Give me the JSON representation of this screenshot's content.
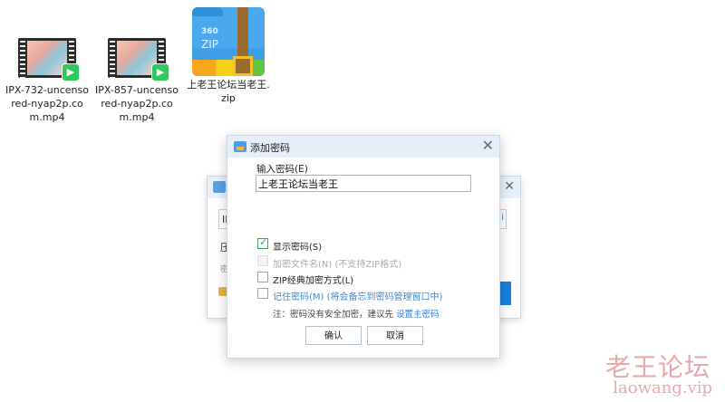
{
  "desktop": {
    "files": [
      {
        "name": "IPX-732-uncensored-nyap2p.com.mp4"
      },
      {
        "name": "IPX-857-uncensored-nyap2p.com.mp4"
      }
    ],
    "zip": {
      "name": "上老王论坛当老王.zip",
      "brand": "360",
      "label": "ZIP"
    }
  },
  "back_dialog": {
    "field_prefix": "IP",
    "label_1": "压",
    "label_2": "密"
  },
  "dialog": {
    "title": "添加密码",
    "password_label": "输入密码(E)",
    "password_value": "上老王论坛当老王",
    "options": [
      {
        "label": "显示密码(S)",
        "checked": true,
        "disabled": false
      },
      {
        "label": "加密文件名(N) (不支持ZIP格式)",
        "checked": false,
        "disabled": true
      },
      {
        "label": "ZIP经典加密方式(L)",
        "checked": false,
        "disabled": false
      },
      {
        "label": "记住密码(M) (将会备忘到密码管理窗口中)",
        "checked": false,
        "disabled": false
      }
    ],
    "note_text": "注：密码没有安全加密，建议先",
    "note_link": "设置主密码",
    "ok_label": "确认",
    "cancel_label": "取消"
  },
  "watermark": {
    "line1": "老王论坛",
    "line2": "laowang.vip"
  },
  "colors": {
    "accent": "#2a7fd4",
    "check": "#3aa455",
    "titlebar": "#e6eef9"
  }
}
